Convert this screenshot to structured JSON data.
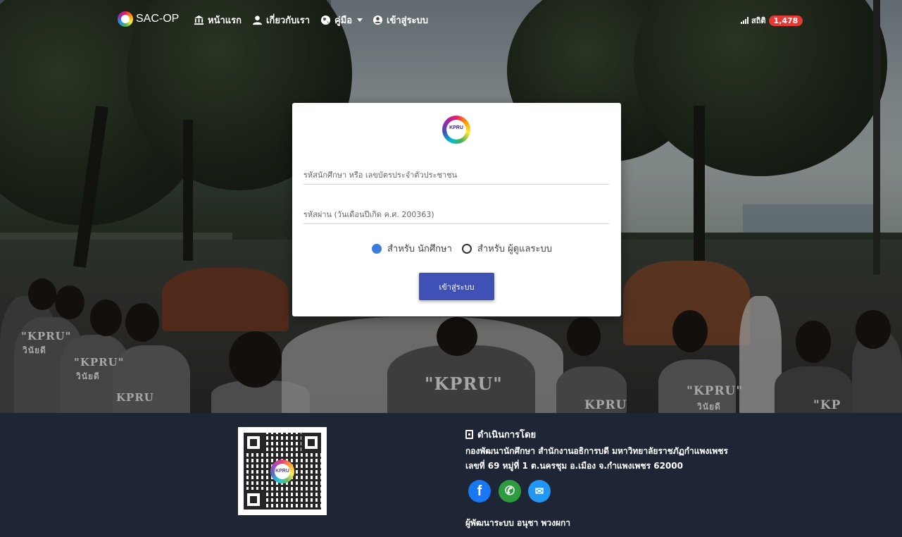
{
  "navbar": {
    "brand": "SAC-OP",
    "items": [
      {
        "label": "หน้าแรก",
        "icon": "bank-icon"
      },
      {
        "label": "เกี่ยวกับเรา",
        "icon": "user-icon"
      },
      {
        "label": "คู่มือ",
        "icon": "globe-icon"
      },
      {
        "label": "เข้าสู่ระบบ",
        "icon": "user-circle-icon"
      }
    ],
    "stat_label": "สถิติ",
    "stat_count": "1,478"
  },
  "login": {
    "logo_text": "KPRU",
    "username_placeholder": "รหัสนักศึกษา หรือ เลขบัตรประจำตัวประชาชน",
    "password_placeholder": "รหัสผ่าน (วันเดือนปีเกิด ค.ศ. 200363)",
    "radio_student": "สำหรับ นักศึกษา",
    "radio_admin": "สำหรับ ผู้ดูแลระบบ",
    "selected": "student",
    "submit_label": "เข้าสู่ระบบ"
  },
  "hero": {
    "shirt_texts": [
      "\"KPRU\"",
      "\"KPRU\"",
      "KPRU",
      "\"KPRU\"",
      "\"KPRU\"",
      "KPRU",
      "\"KP"
    ],
    "shirt_subtexts": [
      "วินัยดี",
      "วินัยดี",
      "วินัยดี"
    ]
  },
  "footer": {
    "qr_logo_text": "KPRU",
    "title": "ดำเนินการโดย",
    "line1": "กองพัฒนานักศึกษา สำนักงานอธิการบดี มหาวิทยาลัยราชภัฏกำแพงเพชร",
    "line2": "เลขที่ 69 หมู่ที่ 1 ต.นครชุม อ.เมือง จ.กำแพงเพชร 62000",
    "social": [
      {
        "name": "facebook-icon",
        "glyph": "f",
        "color": "#1877f2"
      },
      {
        "name": "phone-icon",
        "glyph": "✆",
        "color": "#2e9b3f"
      },
      {
        "name": "ticket-icon",
        "glyph": "✉",
        "color": "#2196f3"
      }
    ],
    "developer": "ผู้พัฒนาระบบ อนุชา พวงผกา"
  },
  "colors": {
    "primary_button": "#3f51b5",
    "radio_selected": "#3b7ddd",
    "badge": "#e53935",
    "footer_bg": "#1e2535"
  }
}
